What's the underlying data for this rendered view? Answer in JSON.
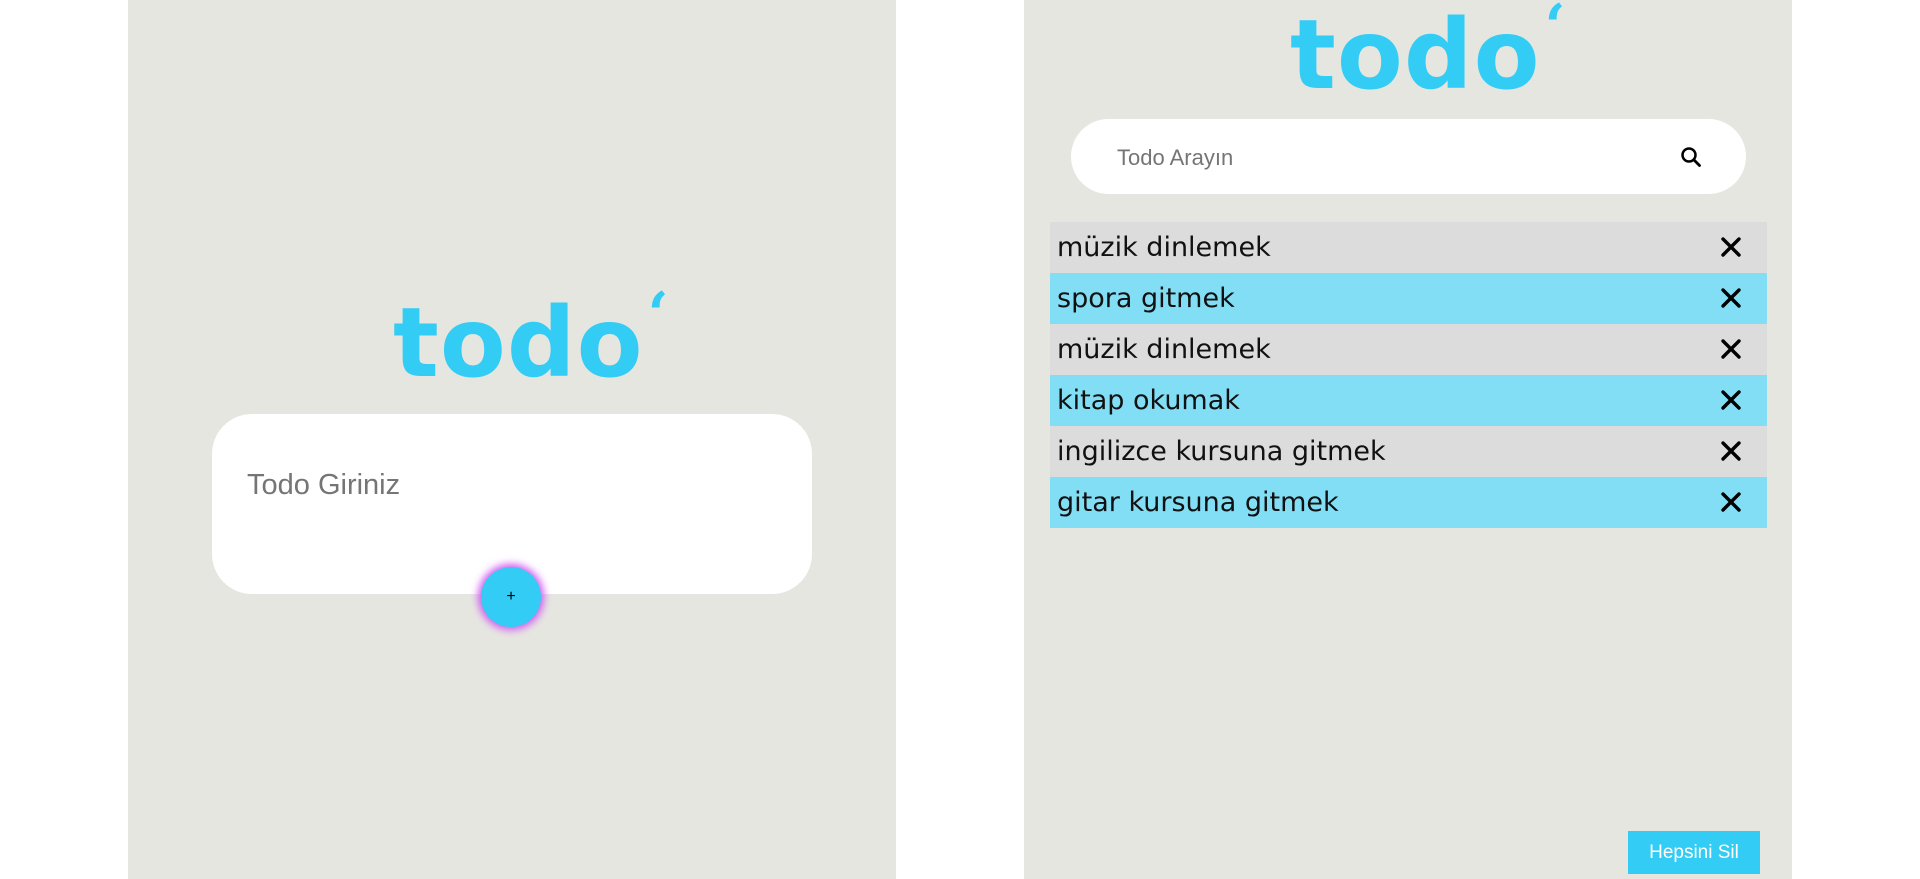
{
  "left": {
    "logo_text": "todo",
    "logo_mark": "‘",
    "input": {
      "placeholder": "Todo Giriniz",
      "value": ""
    },
    "add_button_label": "+"
  },
  "right": {
    "logo_text": "todo",
    "logo_mark": "‘",
    "search": {
      "placeholder": "Todo Arayın",
      "value": "",
      "icon": "search-icon"
    },
    "todos": [
      {
        "text": "müzik dinlemek",
        "icon": "close-icon"
      },
      {
        "text": "spora gitmek",
        "icon": "close-icon"
      },
      {
        "text": "müzik dinlemek",
        "icon": "close-icon"
      },
      {
        "text": "kitap okumak",
        "icon": "close-icon"
      },
      {
        "text": "ingilizce kursuna gitmek",
        "icon": "close-icon"
      },
      {
        "text": "gitar kursuna gitmek",
        "icon": "close-icon"
      }
    ],
    "clear_all_label": "Hepsini Sil"
  },
  "colors": {
    "accent": "#33ccf4",
    "panel_bg": "#e6e6e1",
    "row_odd": "#dddcdc",
    "row_even": "#82def5",
    "button_glow": "#d05cf0"
  }
}
